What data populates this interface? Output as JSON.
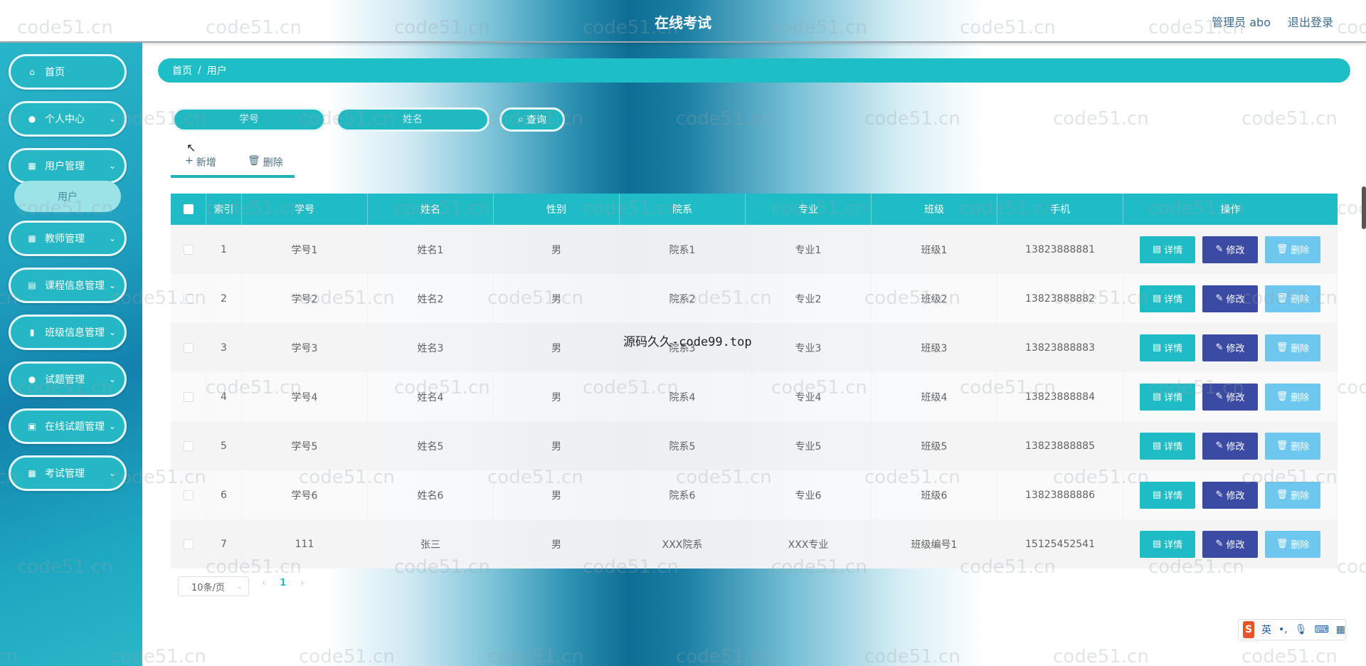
{
  "header": {
    "title": "在线考试",
    "user_label": "管理员 abo",
    "logout_label": "退出登录"
  },
  "sidebar": {
    "items": [
      {
        "label": "首页",
        "icon": "home-icon"
      },
      {
        "label": "个人中心",
        "icon": "user-icon"
      },
      {
        "label": "用户管理",
        "icon": "grid-icon"
      },
      {
        "label": "教师管理",
        "icon": "grid-icon"
      },
      {
        "label": "课程信息管理",
        "icon": "clipboard-icon"
      },
      {
        "label": "班级信息管理",
        "icon": "class-icon"
      },
      {
        "label": "试题管理",
        "icon": "pin-icon"
      },
      {
        "label": "在线试题管理",
        "icon": "doc-icon"
      },
      {
        "label": "考试管理",
        "icon": "grid-icon"
      }
    ],
    "submenu": {
      "label": "用户"
    }
  },
  "breadcrumb": {
    "home": "首页",
    "separator": "/",
    "current": "用户"
  },
  "search": {
    "student_no_placeholder": "学号",
    "name_placeholder": "姓名",
    "query_label": "查询"
  },
  "actions": {
    "add_label": "新增",
    "delete_label": "删除"
  },
  "table": {
    "headers": [
      "索引",
      "学号",
      "姓名",
      "性别",
      "院系",
      "专业",
      "班级",
      "手机",
      "操作"
    ],
    "rows": [
      {
        "index": "1",
        "student_no": "学号1",
        "name": "姓名1",
        "gender": "男",
        "dept": "院系1",
        "major": "专业1",
        "class": "班级1",
        "phone": "13823888881"
      },
      {
        "index": "2",
        "student_no": "学号2",
        "name": "姓名2",
        "gender": "男",
        "dept": "院系2",
        "major": "专业2",
        "class": "班级2",
        "phone": "13823888882"
      },
      {
        "index": "3",
        "student_no": "学号3",
        "name": "姓名3",
        "gender": "男",
        "dept": "院系3",
        "major": "专业3",
        "class": "班级3",
        "phone": "13823888883"
      },
      {
        "index": "4",
        "student_no": "学号4",
        "name": "姓名4",
        "gender": "男",
        "dept": "院系4",
        "major": "专业4",
        "class": "班级4",
        "phone": "13823888884"
      },
      {
        "index": "5",
        "student_no": "学号5",
        "name": "姓名5",
        "gender": "男",
        "dept": "院系5",
        "major": "专业5",
        "class": "班级5",
        "phone": "13823888885"
      },
      {
        "index": "6",
        "student_no": "学号6",
        "name": "姓名6",
        "gender": "男",
        "dept": "院系6",
        "major": "专业6",
        "class": "班级6",
        "phone": "13823888886"
      },
      {
        "index": "7",
        "student_no": "111",
        "name": "张三",
        "gender": "男",
        "dept": "XXX院系",
        "major": "XXX专业",
        "class": "班级编号1",
        "phone": "15125452541"
      }
    ],
    "row_actions": {
      "detail": "详情",
      "edit": "修改",
      "delete": "删除"
    }
  },
  "pagination": {
    "page_size": "10条/页",
    "current_page": "1",
    "prev": "‹",
    "next": "›"
  },
  "watermark": {
    "site": "code51.cn",
    "center": "源码久久-code99.top"
  },
  "ime": {
    "logo": "S",
    "lang": "英",
    "punct": "•,",
    "mic": "🎙",
    "keyboard": "⌨",
    "grid": "▦"
  },
  "colors": {
    "accent": "#1fbcc6",
    "edit": "#3b4aa2",
    "delete": "#6ec7ee"
  }
}
